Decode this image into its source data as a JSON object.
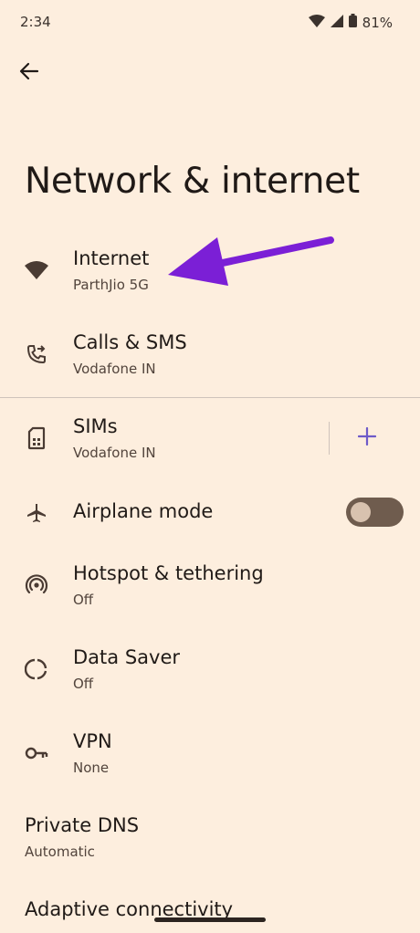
{
  "status": {
    "time": "2:34",
    "battery": "81%"
  },
  "page": {
    "title": "Network & internet"
  },
  "items": {
    "internet": {
      "title": "Internet",
      "subtitle": "ParthJio 5G"
    },
    "calls": {
      "title": "Calls & SMS",
      "subtitle": "Vodafone IN"
    },
    "sims": {
      "title": "SIMs",
      "subtitle": "Vodafone IN"
    },
    "airplane": {
      "title": "Airplane mode",
      "enabled": false
    },
    "hotspot": {
      "title": "Hotspot & tethering",
      "subtitle": "Off"
    },
    "datasaver": {
      "title": "Data Saver",
      "subtitle": "Off"
    },
    "vpn": {
      "title": "VPN",
      "subtitle": "None"
    },
    "dns": {
      "title": "Private DNS",
      "subtitle": "Automatic"
    },
    "adaptive": {
      "title": "Adaptive connectivity"
    }
  },
  "icons": {
    "back": "arrow-left-icon",
    "internet": "wifi-icon",
    "calls": "phone-forward-icon",
    "sims": "sim-card-icon",
    "add": "plus-icon",
    "airplane": "airplane-icon",
    "hotspot": "hotspot-icon",
    "datasaver": "data-saver-icon",
    "vpn": "key-icon"
  },
  "colors": {
    "background": "#fdeede",
    "accent": "#6e5ac8",
    "annotation": "#7b1fd6",
    "toggle_track": "#6f5c4e"
  }
}
